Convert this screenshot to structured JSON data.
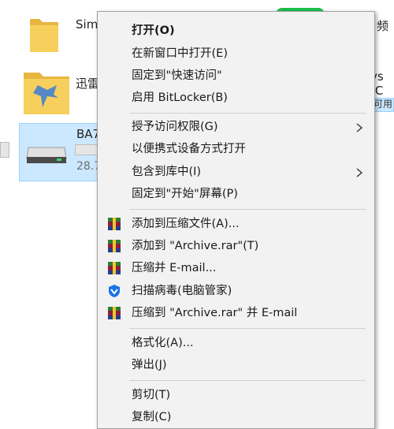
{
  "background": {
    "files": [
      {
        "name_fragment": "Sim"
      },
      {
        "name_fragment": "迅雷"
      },
      {
        "name_fragment": "BA7",
        "size_fragment": "28.7"
      }
    ],
    "right_fragments": [
      "频",
      "vs (C",
      "可用"
    ]
  },
  "menu": {
    "items": [
      {
        "label": "打开(O)"
      },
      {
        "label": "在新窗口中打开(E)"
      },
      {
        "label": "固定到\"快速访问\""
      },
      {
        "label": "启用 BitLocker(B)"
      },
      {
        "label": "授予访问权限(G)"
      },
      {
        "label": "以便携式设备方式打开"
      },
      {
        "label": "包含到库中(I)"
      },
      {
        "label": "固定到\"开始\"屏幕(P)"
      },
      {
        "label": "添加到压缩文件(A)..."
      },
      {
        "label": "添加到 \"Archive.rar\"(T)"
      },
      {
        "label": "压缩并 E-mail..."
      },
      {
        "label": "扫描病毒(电脑管家)"
      },
      {
        "label": "压缩到 \"Archive.rar\" 并 E-mail"
      },
      {
        "label": "格式化(A)..."
      },
      {
        "label": "弹出(J)"
      },
      {
        "label": "剪切(T)"
      },
      {
        "label": "复制(C)"
      }
    ],
    "icons": {
      "submenu": "chevron-right-icon",
      "winrar": "winrar-icon",
      "antivirus": "tencent-pc-manager-icon"
    }
  },
  "colors": {
    "menu_bg": "#f2f2f2",
    "selection_tile": "#cce8ff",
    "accent_green": "#19c04a",
    "antivirus_blue": "#1a73e8"
  }
}
